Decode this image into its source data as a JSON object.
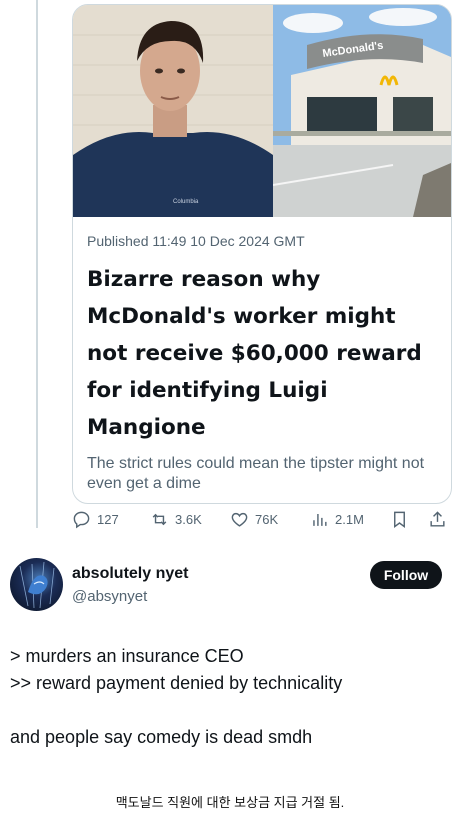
{
  "article": {
    "published": "Published 11:49 10 Dec 2024 GMT",
    "headline": "Bizarre reason why McDonald's worker might not receive $60,000 reward for identifying Luigi Mangione",
    "subline": "The strict rules could mean the tipster might not even get a dime",
    "store_sign": "McDonald's",
    "shirt_brand": "Columbia"
  },
  "actions": {
    "replies": "127",
    "reposts": "3.6K",
    "likes": "76K",
    "views": "2.1M"
  },
  "author": {
    "display_name": "absolutely nyet",
    "handle": "@absynyet",
    "follow_label": "Follow"
  },
  "tweet": {
    "line1": "> murders an insurance CEO",
    "line2": ">> reward payment denied by technicality",
    "line3": "and people say comedy is dead smdh"
  },
  "caption": "맥도날드 직원에 대한 보상금 지급 거절 됨."
}
